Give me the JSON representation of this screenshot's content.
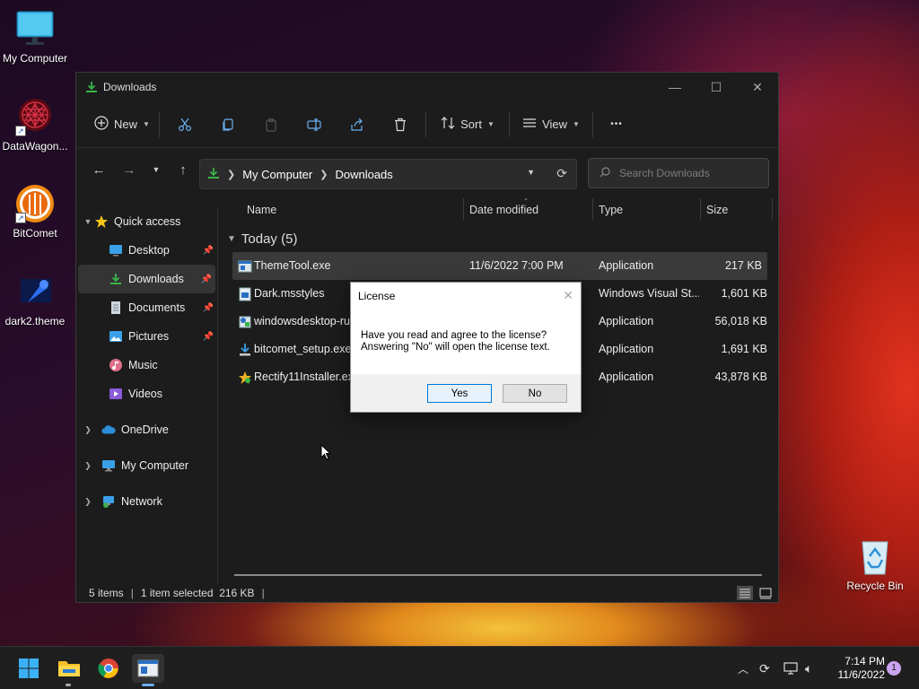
{
  "desktop": {
    "icons": [
      {
        "label": "My Computer",
        "icon": "monitor-icon"
      },
      {
        "label": "DataWagon...",
        "icon": "datawagon-icon"
      },
      {
        "label": "BitComet",
        "icon": "bitcomet-icon"
      },
      {
        "label": "dark2.theme",
        "icon": "theme-file-icon"
      },
      {
        "label": "Recycle Bin",
        "icon": "recycle-bin-icon"
      }
    ]
  },
  "window": {
    "title": "Downloads",
    "controls": {
      "minimize": "—",
      "maximize": "☐",
      "close": "✕"
    }
  },
  "toolbar": {
    "new_label": "New",
    "sort_label": "Sort",
    "view_label": "View",
    "more_label": "•••"
  },
  "address": {
    "crumbs": [
      "My Computer",
      "Downloads"
    ]
  },
  "search": {
    "placeholder": "Search Downloads"
  },
  "sidebar": {
    "items": [
      {
        "label": "Quick access"
      },
      {
        "label": "Desktop"
      },
      {
        "label": "Downloads"
      },
      {
        "label": "Documents"
      },
      {
        "label": "Pictures"
      },
      {
        "label": "Music"
      },
      {
        "label": "Videos"
      },
      {
        "label": "OneDrive"
      },
      {
        "label": "My Computer"
      },
      {
        "label": "Network"
      }
    ]
  },
  "columns": {
    "name": "Name",
    "date": "Date modified",
    "type": "Type",
    "size": "Size"
  },
  "group": {
    "label": "Today (5)"
  },
  "files": [
    {
      "name": "ThemeTool.exe",
      "date": "11/6/2022 7:00 PM",
      "type": "Application",
      "size": "217 KB"
    },
    {
      "name": "Dark.msstyles",
      "date": "",
      "type": "Windows Visual St...",
      "size": "1,601 KB"
    },
    {
      "name": "windowsdesktop-runtime",
      "date": "",
      "type": "Application",
      "size": "56,018 KB"
    },
    {
      "name": "bitcomet_setup.exe",
      "date": "",
      "type": "Application",
      "size": "1,691 KB"
    },
    {
      "name": "Rectify11Installer.exe",
      "date": "",
      "type": "Application",
      "size": "43,878 KB"
    }
  ],
  "status": {
    "items": "5 items",
    "selected": "1 item selected  216 KB",
    "sep": "|"
  },
  "dialog": {
    "title": "License",
    "line1": "Have you read and agree to the license?",
    "line2": "Answering \"No\" will open the license text.",
    "yes": "Yes",
    "no": "No",
    "close": "✕"
  },
  "taskbar": {
    "time": "7:14 PM",
    "date": "11/6/2022",
    "notifications": "1"
  }
}
